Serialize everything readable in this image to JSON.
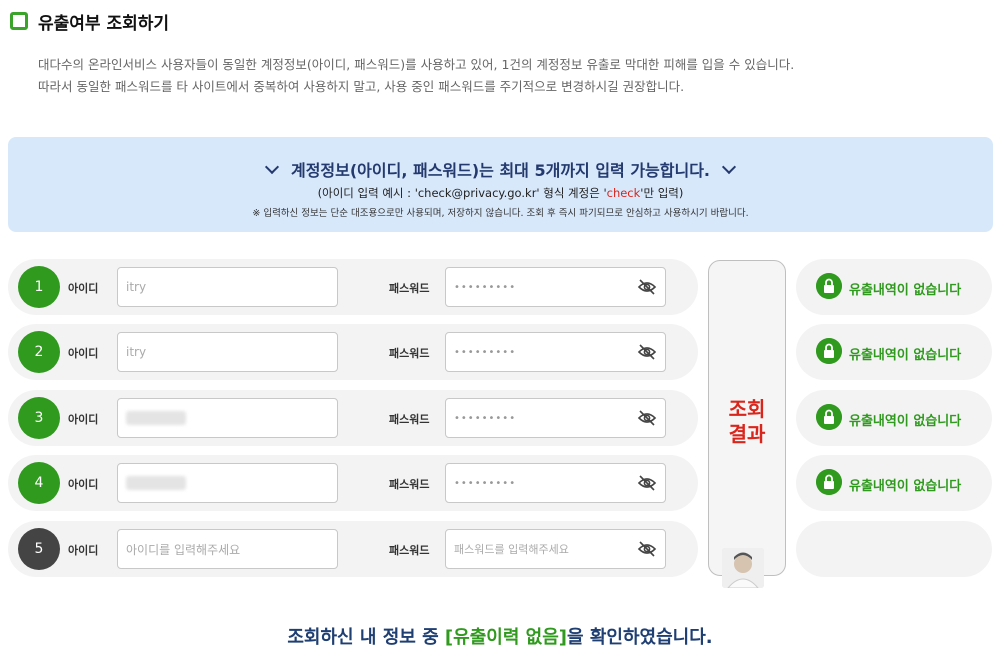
{
  "header": {
    "title": "유출여부 조회하기"
  },
  "description": [
    "대다수의 온라인서비스 사용자들이 동일한 계정정보(아이디, 패스워드)를 사용하고 있어, 1건의 계정정보 유출로 막대한 피해를 입을 수 있습니다.",
    "따라서 동일한 패스워드를 타 사이트에서 중복하여 사용하지 말고, 사용 중인 패스워드를 주기적으로 변경하시길 권장합니다."
  ],
  "notice": {
    "headline": "계정정보(아이디, 패스워드)는 최대 5개까지 입력 가능합니다.",
    "example_prefix": "(아이디 입력 예시 : 'check@privacy.go.kr' 형식 계정은 '",
    "example_highlight": "check",
    "example_suffix": "'만 입력)",
    "disclaimer": "※ 입력하신 정보는 단순 대조용으로만 사용되며, 저장하지 않습니다. 조회 후 즉시 파기되므로 안심하고 사용하시기 바랍니다."
  },
  "labels": {
    "id": "아이디",
    "password": "패스워드"
  },
  "rows": [
    {
      "number": "1",
      "id_value": "itry",
      "password_mask": "•••••••••",
      "result": "유출내역이 없습니다"
    },
    {
      "number": "2",
      "id_value": "itry",
      "password_mask": "•••••••••",
      "result": "유출내역이 없습니다"
    },
    {
      "number": "3",
      "id_value": "",
      "password_mask": "•••••••••",
      "result": "유출내역이 없습니다"
    },
    {
      "number": "4",
      "id_value": "",
      "password_mask": "•••••••••",
      "result": "유출내역이 없습니다"
    },
    {
      "number": "5",
      "id_placeholder": "아이디를 입력해주세요",
      "password_placeholder": "패스워드를 입력해주세요"
    }
  ],
  "result_button": {
    "line1": "조회",
    "line2": "결과"
  },
  "summary": {
    "prefix": "조회하신 내 정보 중 ",
    "highlight": "[유출이력 없음]",
    "suffix": "을 확인하였습니다."
  },
  "colors": {
    "accent_green": "#2f9a1e",
    "notice_bg": "#d8e8fb",
    "result_red": "#d9261c",
    "summary_blue": "#1f3f73"
  },
  "icons": {
    "eye": "eye-off-icon",
    "lock": "lock-icon",
    "chevron": "chevron-down-icon"
  }
}
